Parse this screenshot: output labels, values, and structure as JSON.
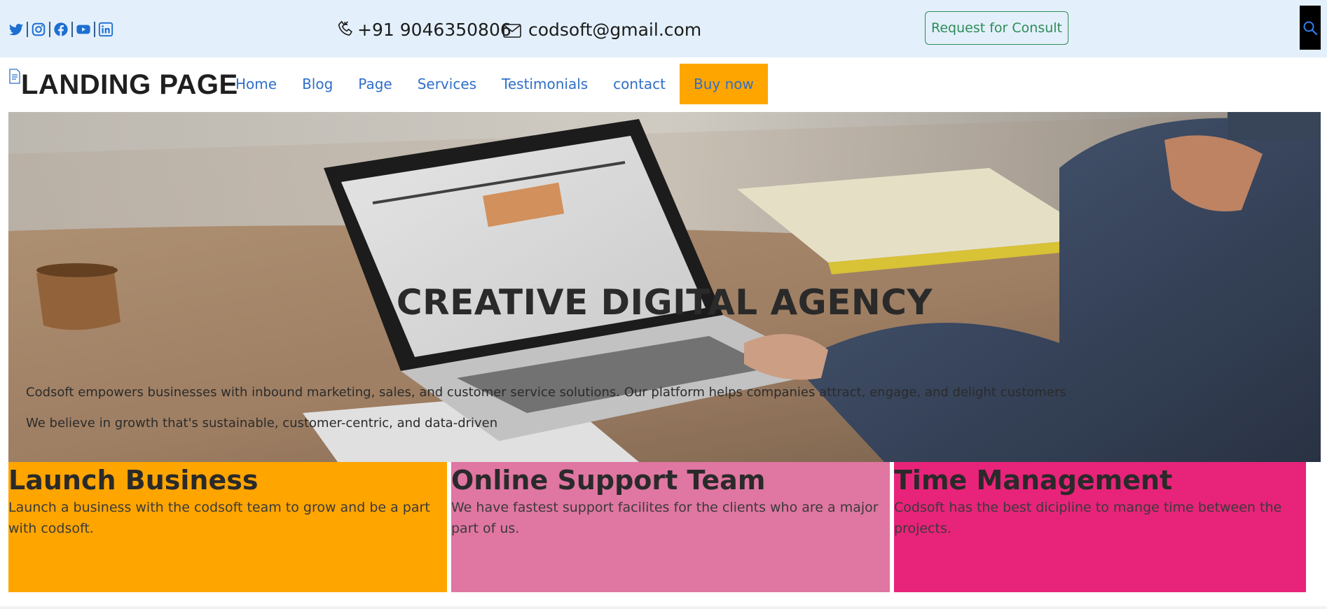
{
  "topbar": {
    "social_icons": [
      "twitter-icon",
      "instagram-icon",
      "facebook-icon",
      "youtube-icon",
      "linkedin-icon"
    ],
    "phone": "+91 9046350806",
    "email": "codsoft@gmail.com",
    "consult_label": "Request for Consult"
  },
  "nav": {
    "brand": "LANDING PAGE",
    "links": [
      "Home",
      "Blog",
      "Page",
      "Services",
      "Testimonials",
      "contact"
    ],
    "buy_label": "Buy now"
  },
  "hero": {
    "title": "CREATIVE DIGITAL AGENCY",
    "paragraph_1": "Codsoft empowers businesses with inbound marketing, sales, and customer service solutions. Our platform helps companies attract, engage, and delight customers",
    "paragraph_2": "We believe in growth that's sustainable, customer-centric, and data-driven"
  },
  "features": [
    {
      "title": "Launch Business",
      "text": "Launch a business with the codsoft team to grow and be a part with codsoft.",
      "color": "#ffa500"
    },
    {
      "title": "Online Support Team",
      "text": "We have fastest support facilites for the clients who are a major part of us.",
      "color": "#e076a2"
    },
    {
      "title": "Time Management",
      "text": "Codsoft has the best dicipline to mange time between the projects.",
      "color": "#e8237a"
    }
  ],
  "colors": {
    "topbar_bg": "#e3f0fb",
    "link": "#2f6fc8",
    "consult_border": "#2e8b57",
    "buy_bg": "#ffa500"
  }
}
